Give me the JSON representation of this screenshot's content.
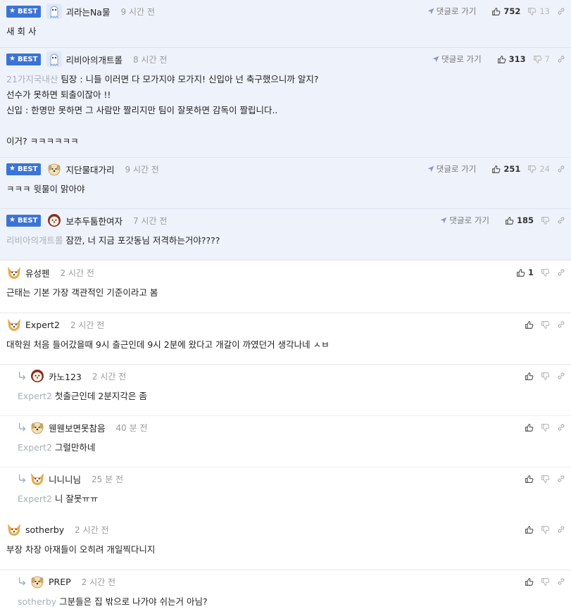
{
  "labels": {
    "best": "BEST",
    "goto": "댓글로 가기"
  },
  "icons": [
    "star-icon",
    "reply-arrow-icon",
    "thumbs-up-icon",
    "thumbs-down-icon",
    "link-icon",
    "send-icon"
  ],
  "colors": {
    "best_bg": "#eef2fb",
    "badge": "#3b74d6",
    "divider": "#e4e7ee"
  },
  "comments": [
    {
      "best": true,
      "name": "괴라는Na물",
      "time": "9 시간 전",
      "up": "752",
      "down": "13",
      "tag": "",
      "lines": [
        "새 회 사"
      ]
    },
    {
      "best": true,
      "name": "리비아의개트롤",
      "time": "8 시간 전",
      "up": "313",
      "down": "7",
      "tag": "21가지국내산",
      "lines": [
        "팀장 : 니들 이러면 다 모가지야 모가지! 신입아 넌 축구했으니까 알지?",
        "선수가 못하면 퇴출이잖아 !!",
        "신입 : 한명만 못하면 그 사람만 짤리지만 팀이 잘못하면 감독이 짤립니다..",
        "",
        "이거? ㅋㅋㅋㅋㅋㅋ"
      ]
    },
    {
      "best": true,
      "name": "지단물대가리",
      "time": "9 시간 전",
      "up": "251",
      "down": "24",
      "tag": "",
      "lines": [
        "ㅋㅋㅋ 윗물이 맑아야"
      ]
    },
    {
      "best": true,
      "name": "보추두툼한여자",
      "time": "7 시간 전",
      "up": "185",
      "down": "",
      "tag": "리비아의개트롤",
      "lines": [
        "잠깐, 너 지금 포갓동님 저격하는거야????"
      ]
    },
    {
      "best": false,
      "name": "유성펜",
      "time": "2 시간 전",
      "up": "1",
      "down": "",
      "tag": "",
      "lines": [
        "근태는 기본 가장 객관적인 기준이라고 봄"
      ]
    },
    {
      "best": false,
      "name": "Expert2",
      "time": "2 시간 전",
      "up": "",
      "down": "",
      "tag": "",
      "lines": [
        "대학원 처음 들어갔을때 9시 출근인데 9시 2분에 왔다고 개갈이 까였던거 생각나네 ㅅㅂ"
      ]
    },
    {
      "best": false,
      "name": "카노123",
      "time": "2 시간 전",
      "up": "",
      "down": "",
      "tag": "Expert2",
      "lines": [
        "첫출근인데 2분지각은 좀"
      ]
    },
    {
      "best": false,
      "name": "웬웬보면못참음",
      "time": "40 분 전",
      "up": "",
      "down": "",
      "tag": "Expert2",
      "lines": [
        "그럴만하네"
      ]
    },
    {
      "best": false,
      "name": "니니니님",
      "time": "25 분 전",
      "up": "",
      "down": "",
      "tag": "Expert2",
      "lines": [
        "니 잘못ㅠㅠ"
      ]
    },
    {
      "best": false,
      "name": "sotherby",
      "time": "2 시간 전",
      "up": "",
      "down": "",
      "tag": "",
      "lines": [
        "부장 차장 아재들이 오히려 개일찍다니지"
      ]
    },
    {
      "best": false,
      "name": "PREP",
      "time": "2 시간 전",
      "up": "",
      "down": "",
      "tag": "sotherby",
      "lines": [
        "그분들은 집 밖으로 나가야 쉬는거 아님?"
      ]
    }
  ]
}
